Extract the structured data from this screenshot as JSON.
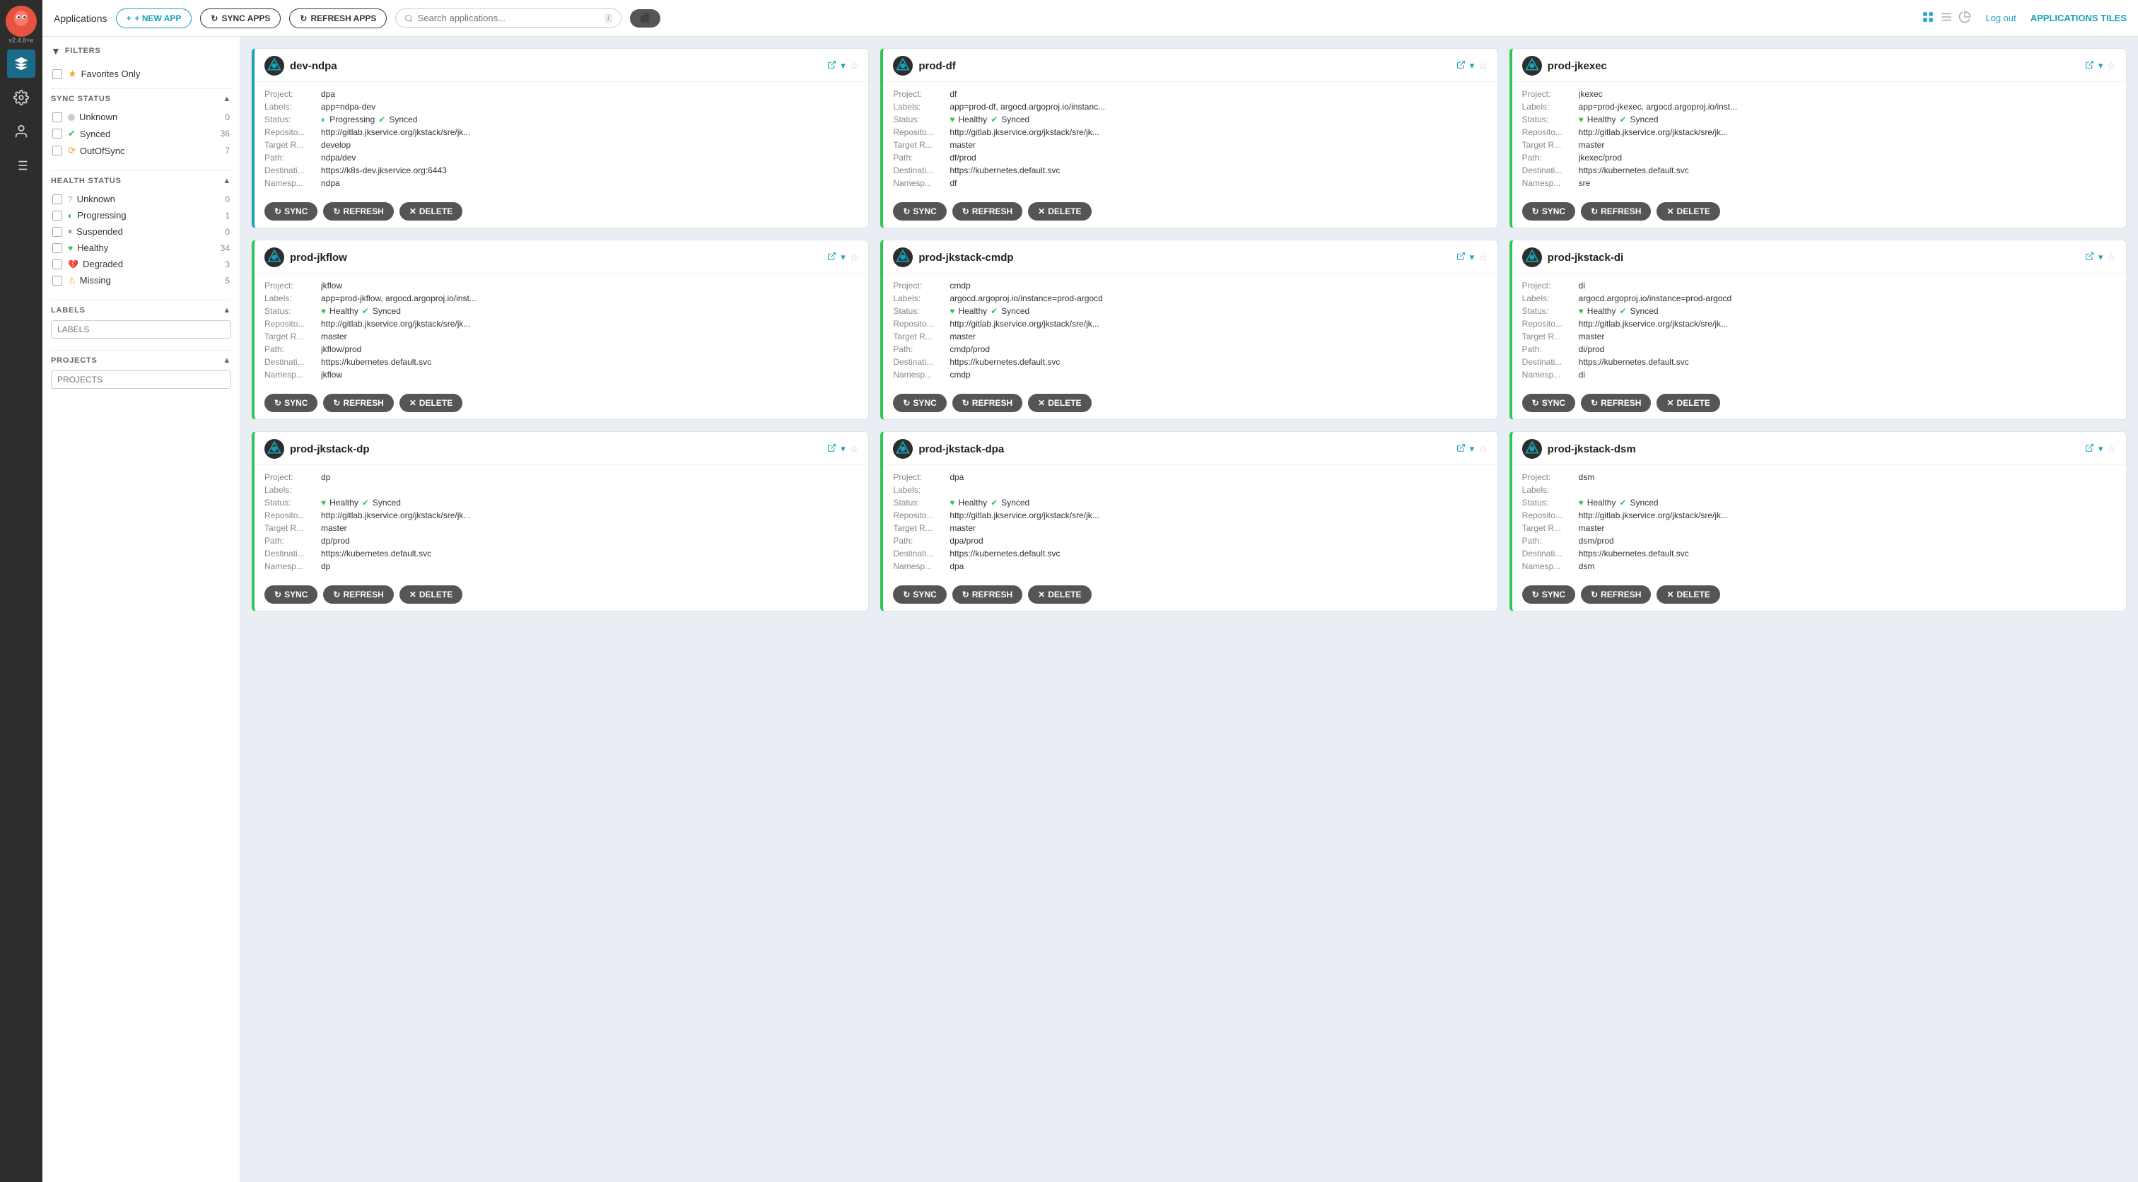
{
  "nav": {
    "version": "v2.4.8+e",
    "items": [
      {
        "id": "layers",
        "icon": "layers"
      },
      {
        "id": "settings",
        "icon": "settings"
      },
      {
        "id": "user",
        "icon": "user"
      },
      {
        "id": "list",
        "icon": "list"
      }
    ]
  },
  "topbar": {
    "title": "Applications",
    "right_title": "APPLICATIONS TILES",
    "buttons": {
      "new_app": "+ NEW APP",
      "sync_apps": "↻ SYNC APPS",
      "refresh_apps": "↻ REFRESH APPS"
    },
    "search_placeholder": "Search applications...",
    "logout": "Log out"
  },
  "sidebar": {
    "filters_label": "FILTERS",
    "favorites_label": "Favorites Only",
    "sync_status": {
      "label": "SYNC STATUS",
      "items": [
        {
          "name": "Unknown",
          "count": 0,
          "dot": "unknown"
        },
        {
          "name": "Synced",
          "count": 36,
          "dot": "synced"
        },
        {
          "name": "OutOfSync",
          "count": 7,
          "dot": "outofSync"
        }
      ]
    },
    "health_status": {
      "label": "HEALTH STATUS",
      "items": [
        {
          "name": "Unknown",
          "count": 0,
          "dot": "unknown"
        },
        {
          "name": "Progressing",
          "count": 1,
          "dot": "progressing"
        },
        {
          "name": "Suspended",
          "count": 0,
          "dot": "suspended"
        },
        {
          "name": "Healthy",
          "count": 34,
          "dot": "healthy"
        },
        {
          "name": "Degraded",
          "count": 3,
          "dot": "degraded"
        },
        {
          "name": "Missing",
          "count": 5,
          "dot": "missing"
        }
      ]
    },
    "labels": {
      "label": "LABELS",
      "placeholder": "LABELS"
    },
    "projects": {
      "label": "PROJECTS",
      "placeholder": "PROJECTS"
    }
  },
  "apps": [
    {
      "id": "dev-ndpa",
      "name": "dev-ndpa",
      "border": "blue",
      "project": "dpa",
      "labels": "app=ndpa-dev",
      "status": "Progressing Synced",
      "status_health": "Progressing",
      "status_sync": "Synced",
      "repo": "http://gitlab.jkservice.org/jkstack/sre/jk...",
      "target_rev": "develop",
      "path": "ndpa/dev",
      "destination": "https://k8s-dev.jkservice.org:6443",
      "namespace": "ndpa"
    },
    {
      "id": "prod-df",
      "name": "prod-df",
      "border": "green",
      "project": "df",
      "labels": "app=prod-df, argocd.argoproj.io/instanc...",
      "status": "Healthy Synced",
      "status_health": "Healthy",
      "status_sync": "Synced",
      "repo": "http://gitlab.jkservice.org/jkstack/sre/jk...",
      "target_rev": "master",
      "path": "df/prod",
      "destination": "https://kubernetes.default.svc",
      "namespace": "df"
    },
    {
      "id": "prod-jkexec",
      "name": "prod-jkexec",
      "border": "green",
      "project": "jkexec",
      "labels": "app=prod-jkexec, argocd.argoproj.io/inst...",
      "status": "Healthy Synced",
      "status_health": "Healthy",
      "status_sync": "Synced",
      "repo": "http://gitlab.jkservice.org/jkstack/sre/jk...",
      "target_rev": "master",
      "path": "jkexec/prod",
      "destination": "https://kubernetes.default.svc",
      "namespace": "sre"
    },
    {
      "id": "prod-jkflow",
      "name": "prod-jkflow",
      "border": "green",
      "project": "jkflow",
      "labels": "app=prod-jkflow, argocd.argoproj.io/inst...",
      "status": "Healthy Synced",
      "status_health": "Healthy",
      "status_sync": "Synced",
      "repo": "http://gitlab.jkservice.org/jkstack/sre/jk...",
      "target_rev": "master",
      "path": "jkflow/prod",
      "destination": "https://kubernetes.default.svc",
      "namespace": "jkflow"
    },
    {
      "id": "prod-jkstack-cmdp",
      "name": "prod-jkstack-cmdp",
      "border": "green",
      "project": "cmdp",
      "labels": "argocd.argoproj.io/instance=prod-argocd",
      "status": "Healthy Synced",
      "status_health": "Healthy",
      "status_sync": "Synced",
      "repo": "http://gitlab.jkservice.org/jkstack/sre/jk...",
      "target_rev": "master",
      "path": "cmdp/prod",
      "destination": "https://kubernetes.default.svc",
      "namespace": "cmdp"
    },
    {
      "id": "prod-jkstack-di",
      "name": "prod-jkstack-di",
      "border": "green",
      "project": "di",
      "labels": "argocd.argoproj.io/instance=prod-argocd",
      "status": "Healthy Synced",
      "status_health": "Healthy",
      "status_sync": "Synced",
      "repo": "http://gitlab.jkservice.org/jkstack/sre/jk...",
      "target_rev": "master",
      "path": "di/prod",
      "destination": "https://kubernetes.default.svc",
      "namespace": "di"
    },
    {
      "id": "prod-jkstack-dp",
      "name": "prod-jkstack-dp",
      "border": "green",
      "project": "dp",
      "labels": "",
      "status": "Healthy Synced",
      "status_health": "Healthy",
      "status_sync": "Synced",
      "repo": "http://gitlab.jkservice.org/jkstack/sre/jk...",
      "target_rev": "master",
      "path": "dp/prod",
      "destination": "https://kubernetes.default.svc",
      "namespace": "dp"
    },
    {
      "id": "prod-jkstack-dpa",
      "name": "prod-jkstack-dpa",
      "border": "green",
      "project": "dpa",
      "labels": "",
      "status": "Healthy Synced",
      "status_health": "Healthy",
      "status_sync": "Synced",
      "repo": "http://gitlab.jkservice.org/jkstack/sre/jk...",
      "target_rev": "master",
      "path": "dpa/prod",
      "destination": "https://kubernetes.default.svc",
      "namespace": "dpa"
    },
    {
      "id": "prod-jkstack-dsm",
      "name": "prod-jkstack-dsm",
      "border": "green",
      "project": "dsm",
      "labels": "",
      "status": "Healthy Synced",
      "status_health": "Healthy",
      "status_sync": "Synced",
      "repo": "http://gitlab.jkservice.org/jkstack/sre/jk...",
      "target_rev": "master",
      "path": "dsm/prod",
      "destination": "https://kubernetes.default.svc",
      "namespace": "dsm"
    }
  ],
  "buttons": {
    "sync": "SYNC",
    "refresh": "REFRESH",
    "delete": "DELETE"
  }
}
